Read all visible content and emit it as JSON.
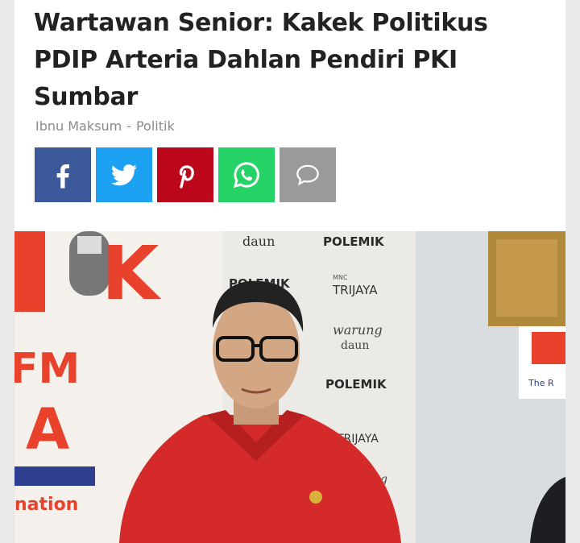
{
  "article": {
    "title": "Wartawan Senior: Kakek Politikus PDIP Arteria Dahlan Pendiri PKI Sumbar",
    "author": "Ibnu Maksum",
    "separator": "-",
    "category": "Politik"
  },
  "share": {
    "buttons": [
      {
        "name": "facebook",
        "icon": "facebook-icon",
        "color": "#3b5998"
      },
      {
        "name": "twitter",
        "icon": "twitter-icon",
        "color": "#1da1f2"
      },
      {
        "name": "pinterest",
        "icon": "pinterest-icon",
        "color": "#bd081c"
      },
      {
        "name": "whatsapp",
        "icon": "whatsapp-icon",
        "color": "#25d366"
      },
      {
        "name": "comment",
        "icon": "comment-icon",
        "color": "#9a9a9a"
      }
    ]
  },
  "photo": {
    "backdrop_text": {
      "daun_top": "daun",
      "polemik_1": "POLEMIK",
      "polemik_2": "POLEMIK",
      "polemik_3": "POLEMIK",
      "mnc": "MNC",
      "trijaya_1": "TRIJAYA",
      "trijaya_2": "TRIJAYA",
      "warung": "warung",
      "daun": "daun",
      "letter_k": "K",
      "fm": "FM",
      "letter_a": "A",
      "nation": "nation",
      "the_r": "The R",
      "ng": "ng"
    }
  }
}
